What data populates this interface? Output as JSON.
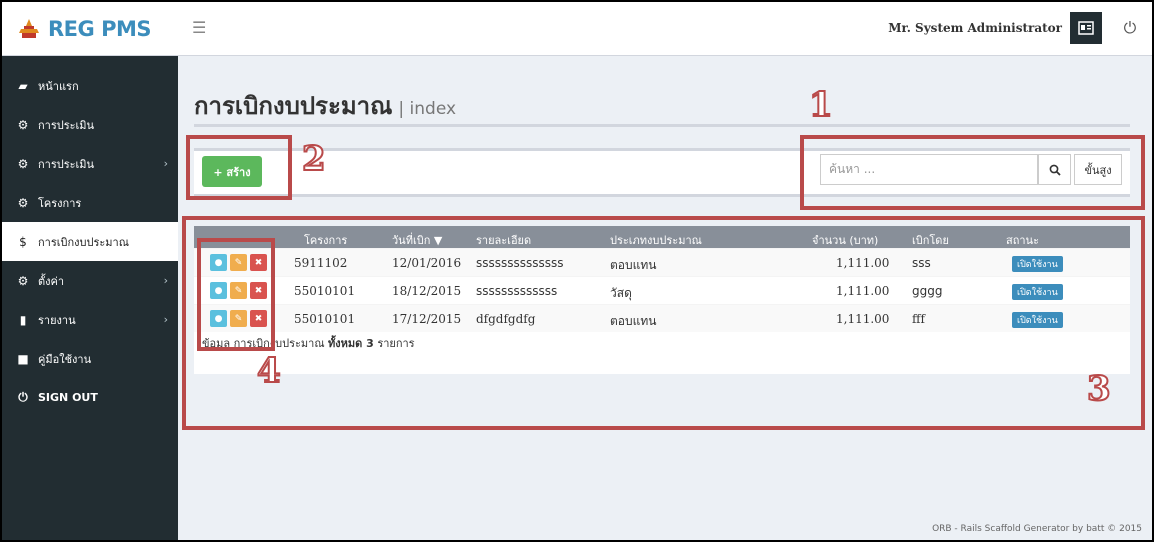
{
  "app": {
    "title": "REG PMS"
  },
  "header": {
    "user_name": "Mr. System Administrator"
  },
  "sidebar": {
    "items": [
      {
        "label": "หน้าแรก",
        "icon": "briefcase-icon",
        "has_children": false,
        "active": false
      },
      {
        "label": "การประเมิน",
        "icon": "cogs-icon",
        "has_children": false,
        "active": false
      },
      {
        "label": "การประเมิน",
        "icon": "gears-icon",
        "has_children": true,
        "active": false
      },
      {
        "label": "โครงการ",
        "icon": "cubes-icon",
        "has_children": false,
        "active": false
      },
      {
        "label": "การเบิกงบประมาณ",
        "icon": "dollar-icon",
        "has_children": false,
        "active": true
      },
      {
        "label": "ตั้งค่า",
        "icon": "gears-icon",
        "has_children": true,
        "active": false
      },
      {
        "label": "รายงาน",
        "icon": "bar-chart-icon",
        "has_children": true,
        "active": false
      },
      {
        "label": "คู่มือใช้งาน",
        "icon": "book-icon",
        "has_children": false,
        "active": false
      },
      {
        "label": "SIGN OUT",
        "icon": "power-icon",
        "has_children": false,
        "active": false
      }
    ]
  },
  "page": {
    "title": "การเบิกงบประมาณ",
    "subtitle": "| index"
  },
  "toolbar": {
    "create_label": "+ สร้าง",
    "search_placeholder": "ค้นหา ...",
    "advanced_label": "ขั้นสูง"
  },
  "table": {
    "columns": [
      "โครงการ",
      "วันที่เบิก ▼",
      "รายละเอียด",
      "ประเภทงบประมาณ",
      "จำนวน (บาท)",
      "เบิกโดย",
      "สถานะ"
    ],
    "rows": [
      {
        "project": "5911102",
        "date": "12/01/2016",
        "detail": "ssssssssssssss",
        "type": "ตอบแทน",
        "amount": "1,111.00",
        "by": "sss",
        "status": "เปิดใช้งาน"
      },
      {
        "project": "55010101",
        "date": "18/12/2015",
        "detail": "sssssssssssss",
        "type": "วัสดุ",
        "amount": "1,111.00",
        "by": "gggg",
        "status": "เปิดใช้งาน"
      },
      {
        "project": "55010101",
        "date": "17/12/2015",
        "detail": "dfgdfgdfg",
        "type": "ตอบแทน",
        "amount": "1,111.00",
        "by": "fff",
        "status": "เปิดใช้งาน"
      }
    ],
    "summary_prefix": "ข้อมูล การเบิกงบประมาณ",
    "summary_total": "ทั้งหมด 3",
    "summary_suffix": "รายการ"
  },
  "footer": {
    "text": "ORB - Rails Scaffold Generator by batt © 2015"
  },
  "annotations": [
    "1",
    "2",
    "3",
    "4"
  ],
  "colors": {
    "brand": "#3c8dbc",
    "sidebar_bg": "#222d32",
    "create_button": "#5cb85c",
    "annotation": "#b94a4a"
  }
}
